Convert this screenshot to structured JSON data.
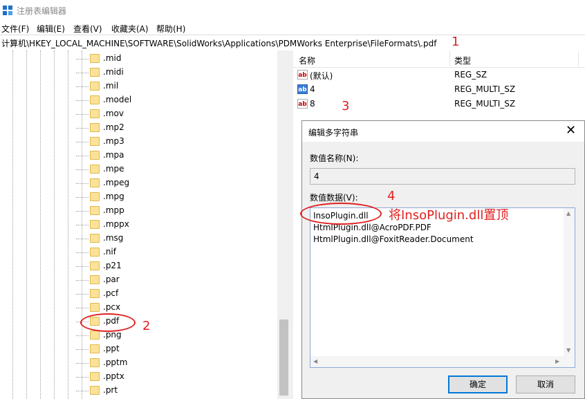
{
  "window": {
    "title": "注册表编辑器"
  },
  "menu": [
    "文件(F)",
    "编辑(E)",
    "查看(V)",
    "收藏夹(A)",
    "帮助(H)"
  ],
  "address": "计算机\\HKEY_LOCAL_MACHINE\\SOFTWARE\\SolidWorks\\Applications\\PDMWorks Enterprise\\FileFormats\\.pdf",
  "tree": {
    "items": [
      ".mid",
      ".midi",
      ".mil",
      ".model",
      ".mov",
      ".mp2",
      ".mp3",
      ".mpa",
      ".mpe",
      ".mpeg",
      ".mpg",
      ".mpp",
      ".mppx",
      ".msg",
      ".nif",
      ".p21",
      ".par",
      ".pcf",
      ".pcx",
      ".pdf",
      ".png",
      ".ppt",
      ".pptm",
      ".pptx",
      ".prt"
    ],
    "selected": ".pdf"
  },
  "values": {
    "columns": {
      "name": "名称",
      "type": "类型"
    },
    "rows": [
      {
        "name": "(默认)",
        "type": "REG_SZ",
        "icon": "ab"
      },
      {
        "name": "4",
        "type": "REG_MULTI_SZ",
        "icon": "ab"
      },
      {
        "name": "8",
        "type": "REG_MULTI_SZ",
        "icon": "ab"
      }
    ]
  },
  "dialog": {
    "title": "编辑多字符串",
    "name_label": "数值名称(N):",
    "name_value": "4",
    "data_label": "数值数据(V):",
    "data_lines": [
      "InsoPlugin.dll",
      "HtmlPlugin.dll@AcroPDF.PDF",
      "HtmlPlugin.dll@FoxitReader.Document"
    ],
    "ok": "确定",
    "cancel": "取消"
  },
  "annotations": {
    "n1": "1",
    "n2": "2",
    "n3": "3",
    "n4": "4",
    "note": "将InsoPlugin.dll置顶",
    "color": "#e02020"
  }
}
